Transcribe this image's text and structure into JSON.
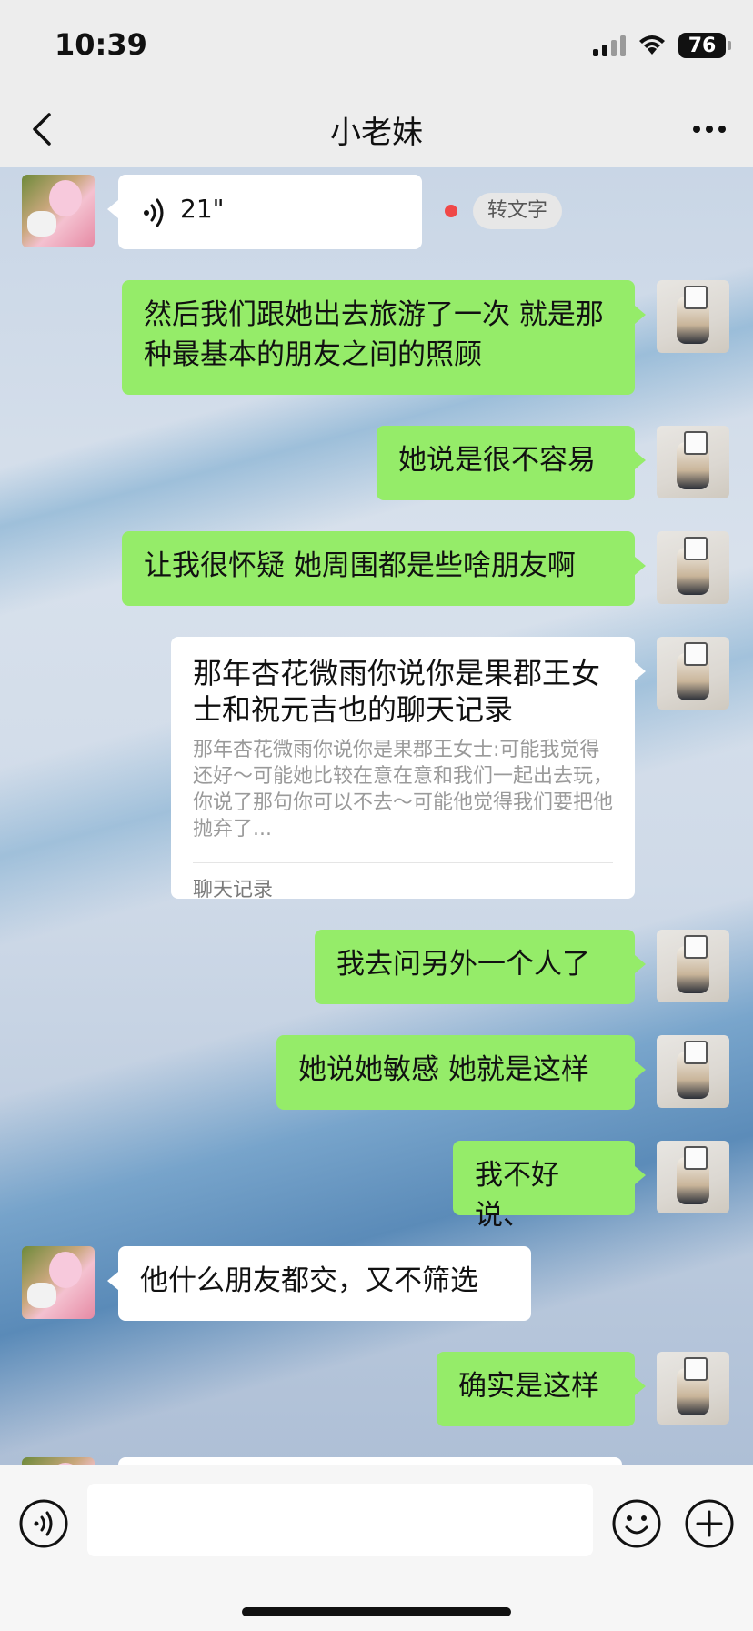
{
  "status_bar": {
    "time": "10:39",
    "battery": "76"
  },
  "nav": {
    "title": "小老妹"
  },
  "messages": [
    {
      "type": "voice",
      "side": "left",
      "duration": "21\"",
      "action": "转文字"
    },
    {
      "type": "text",
      "side": "right",
      "text": "然后我们跟她出去旅游了一次 就是那种最基本的朋友之间的照顾"
    },
    {
      "type": "text",
      "side": "right",
      "text": "她说是很不容易"
    },
    {
      "type": "text",
      "side": "right",
      "text": "让我很怀疑 她周围都是些啥朋友啊"
    },
    {
      "type": "chat_record",
      "side": "right",
      "title": "那年杏花微雨你说你是果郡王女士和祝元吉也的聊天记录",
      "summary": "那年杏花微雨你说你是果郡王女士:可能我觉得还好～可能她比较在意在意和我们一起出去玩，你说了那句你可以不去～可能他觉得我们要把他抛弃了...",
      "footer": "聊天记录"
    },
    {
      "type": "text",
      "side": "right",
      "text": "我去问另外一个人了"
    },
    {
      "type": "text",
      "side": "right",
      "text": "她说她敏感 她就是这样"
    },
    {
      "type": "text",
      "side": "right",
      "text": "我不好说、"
    },
    {
      "type": "text",
      "side": "left",
      "text": "他什么朋友都交，又不筛选"
    },
    {
      "type": "text",
      "side": "right",
      "text": "确实是这样"
    }
  ],
  "input": {
    "placeholder": ""
  }
}
